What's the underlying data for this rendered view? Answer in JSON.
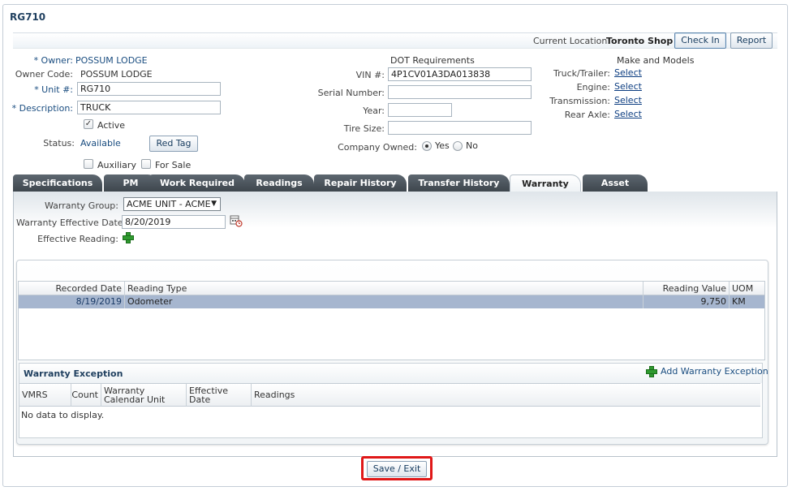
{
  "title": "RG710",
  "header": {
    "current_location_label": "Current Location:",
    "current_location": "Toronto Shop",
    "check_in_label": "Check In",
    "report_label": "Report"
  },
  "unit": {
    "owner_label": "* Owner:",
    "owner": "POSSUM LODGE",
    "owner_code_label": "Owner Code:",
    "owner_code": "POSSUM LODGE",
    "unit_label": "* Unit #:",
    "unit_value": "RG710",
    "description_label": "* Description:",
    "description_value": "TRUCK",
    "active_label": "Active",
    "status_label": "Status:",
    "status": "Available",
    "red_tag_label": "Red Tag",
    "auxiliary_label": "Auxiliary",
    "for_sale_label": "For Sale"
  },
  "dot": {
    "heading": "DOT Requirements",
    "vin_label": "VIN #:",
    "vin_value": "4P1CV01A3DA013838",
    "serial_label": "Serial Number:",
    "serial_value": "",
    "year_label": "Year:",
    "year_value": "",
    "tire_label": "Tire Size:",
    "tire_value": "",
    "company_owned_label": "Company Owned:",
    "yes_label": "Yes",
    "no_label": "No"
  },
  "make_models": {
    "heading": "Make and Models",
    "truck_label": "Truck/Trailer:",
    "engine_label": "Engine:",
    "transmission_label": "Transmission:",
    "rear_axle_label": "Rear Axle:",
    "select_label": "Select"
  },
  "tabs": [
    {
      "label": "Specifications"
    },
    {
      "label": "PM"
    },
    {
      "label": "Work Required"
    },
    {
      "label": "Readings"
    },
    {
      "label": "Repair History"
    },
    {
      "label": "Transfer History"
    },
    {
      "label": "Warranty"
    },
    {
      "label": "Asset"
    }
  ],
  "warranty": {
    "group_label": "Warranty Group:",
    "group_value": "ACME UNIT - ACME",
    "effective_date_label": "Warranty Effective Date:",
    "effective_date_value": "8/20/2019",
    "effective_reading_label": "Effective Reading:",
    "readings_table": {
      "columns": [
        "Recorded Date",
        "Reading Type",
        "Reading Value",
        "UOM"
      ],
      "rows": [
        {
          "date": "8/19/2019",
          "type": "Odometer",
          "value": "9,750",
          "uom": "KM"
        }
      ]
    },
    "exception": {
      "title": "Warranty Exception",
      "add_label": "Add Warranty Exception",
      "columns": [
        "VMRS",
        "Count",
        "Warranty Calendar Unit",
        "Effective Date",
        "Readings"
      ],
      "empty_text": "No data to display."
    }
  },
  "footer": {
    "save_exit_label": "Save / Exit"
  },
  "colors": {
    "tab_dark": "#4a535b",
    "selected_row": "#a6b6cf",
    "highlight": "#e01818",
    "link": "#0b3c80"
  }
}
